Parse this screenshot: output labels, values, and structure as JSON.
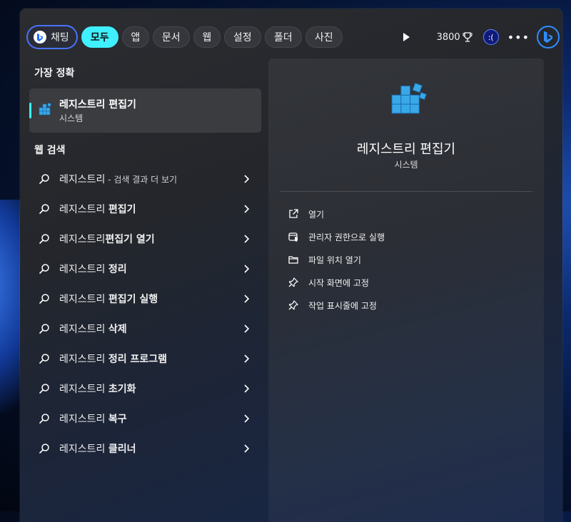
{
  "tabs": {
    "chat": "채팅",
    "all": "모두",
    "apps": "앱",
    "documents": "문서",
    "web": "웹",
    "settings": "설정",
    "folders": "폴더",
    "photos": "사진"
  },
  "rewards": {
    "points": "3800"
  },
  "user": {
    "avatar_text": ":("
  },
  "best_match": {
    "title": "가장 정확",
    "item": {
      "name": "레지스트리 편집기",
      "type": "시스템"
    }
  },
  "web_search": {
    "title": "웹 검색",
    "items": [
      {
        "query": "레지스트리",
        "bold": "",
        "suffix": " - 검색 결과 더 보기"
      },
      {
        "query": "레지스트리 ",
        "bold": "편집기",
        "suffix": ""
      },
      {
        "query": "레지스트리",
        "bold": "편집기 열기",
        "suffix": ""
      },
      {
        "query": "레지스트리 ",
        "bold": "정리",
        "suffix": ""
      },
      {
        "query": "레지스트리 ",
        "bold": "편집기 실행",
        "suffix": ""
      },
      {
        "query": "레지스트리 ",
        "bold": "삭제",
        "suffix": ""
      },
      {
        "query": "레지스트리 ",
        "bold": "정리 프로그램",
        "suffix": ""
      },
      {
        "query": "레지스트리 ",
        "bold": "초기화",
        "suffix": ""
      },
      {
        "query": "레지스트리 ",
        "bold": "복구",
        "suffix": ""
      },
      {
        "query": "레지스트리 ",
        "bold": "클리너",
        "suffix": ""
      }
    ]
  },
  "preview": {
    "name": "레지스트리 편집기",
    "type": "시스템",
    "actions": [
      {
        "label": "열기",
        "icon": "open-external-icon"
      },
      {
        "label": "관리자 권한으로 실행",
        "icon": "admin-shield-icon"
      },
      {
        "label": "파일 위치 열기",
        "icon": "folder-icon"
      },
      {
        "label": "시작 화면에 고정",
        "icon": "pin-icon"
      },
      {
        "label": "작업 표시줄에 고정",
        "icon": "pin-icon"
      }
    ]
  },
  "colors": {
    "accent": "#3ff0ff",
    "chat_border": "#4a72ff",
    "bing_blue": "#2f8cff"
  }
}
